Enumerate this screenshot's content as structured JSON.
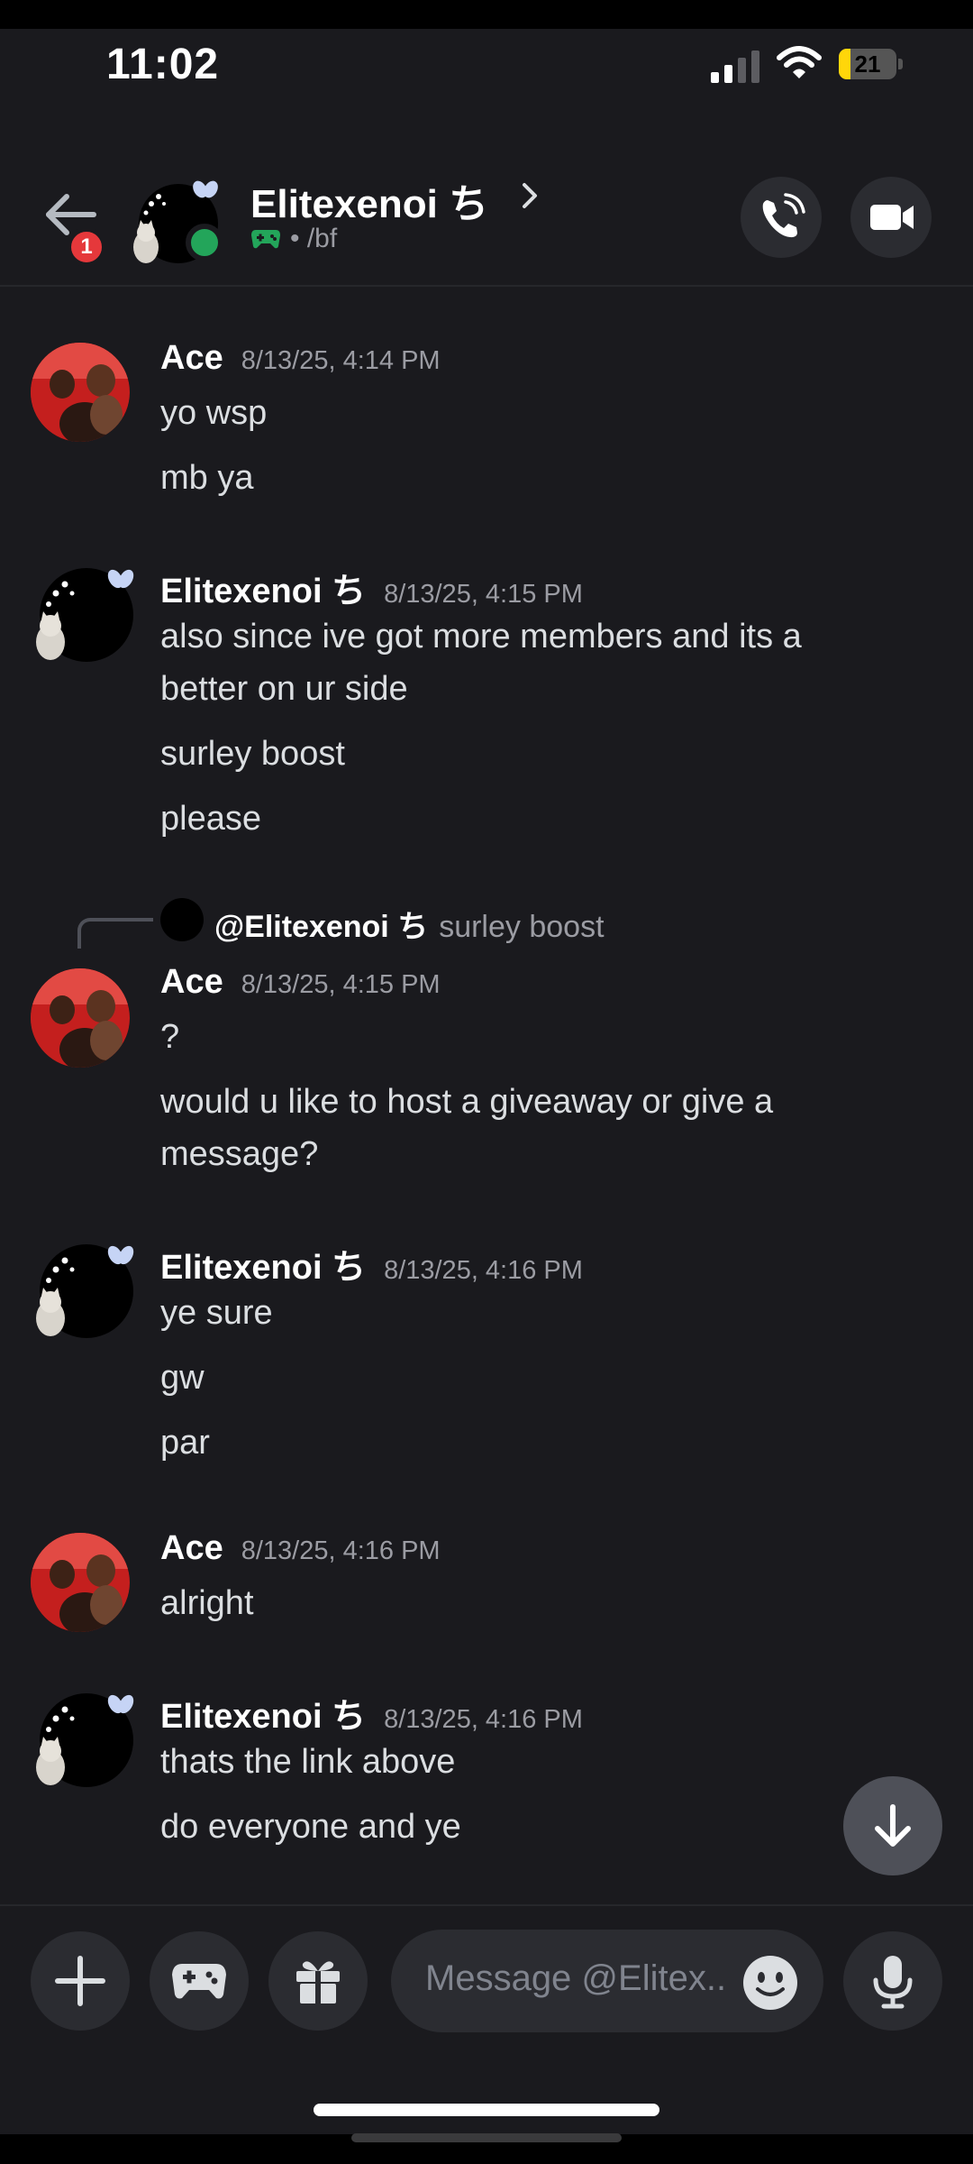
{
  "status_bar": {
    "time": "11:02",
    "battery": "21",
    "battery_level": 0.21
  },
  "header": {
    "name": "Elitexenoi ち",
    "badge_count": "1",
    "status_text": "/bf",
    "icons": [
      "back-arrow-icon",
      "gamepad-icon",
      "phone-call-icon",
      "video-camera-icon",
      "chevron-right-icon"
    ]
  },
  "messages": [
    {
      "author": "Ace",
      "timestamp": "8/13/25, 4:14 PM",
      "lines": [
        "yo wsp",
        "mb ya"
      ]
    },
    {
      "author": "Elitexenoi ち",
      "timestamp": "8/13/25, 4:15 PM",
      "lines": [
        "also since ive got more members and its a",
        "better on ur side",
        "surley boost",
        "please"
      ]
    },
    {
      "reply": {
        "author": "@Elitexenoi ち",
        "text": "surley boost"
      },
      "author": "Ace",
      "timestamp": "8/13/25, 4:15 PM",
      "lines": [
        "?",
        "would u like to host a giveaway or give a",
        "message?"
      ]
    },
    {
      "author": "Elitexenoi ち",
      "timestamp": "8/13/25, 4:16 PM",
      "lines": [
        "ye sure",
        "gw",
        "par"
      ]
    },
    {
      "author": "Ace",
      "timestamp": "8/13/25, 4:16 PM",
      "lines": [
        "alright"
      ]
    },
    {
      "author": "Elitexenoi ち",
      "timestamp": "8/13/25, 4:16 PM",
      "lines": [
        "thats the link above",
        "do everyone and ye"
      ]
    }
  ],
  "composer": {
    "placeholder": "Message @Elitex..",
    "icons": [
      "plus-icon",
      "gamepad-icon",
      "gift-icon",
      "emoji-icon",
      "microphone-icon"
    ]
  },
  "colors": {
    "background": "#1a1a1e",
    "accent_green": "#23a55a",
    "badge_red": "#e5383b",
    "battery_yellow": "#ffd60a"
  }
}
